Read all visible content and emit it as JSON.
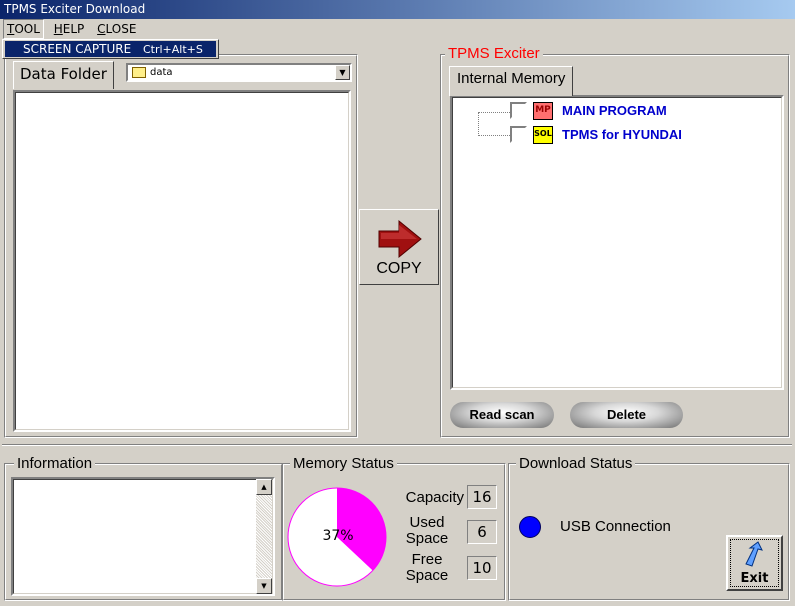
{
  "window": {
    "title": "TPMS Exciter Download"
  },
  "menu": {
    "items": [
      "TOOL",
      "HELP",
      "CLOSE"
    ],
    "open_dropdown": {
      "item": "SCREEN CAPTURE",
      "shortcut": "Ctrl+Alt+S"
    }
  },
  "left_panel": {
    "tab_label": "Data Folder",
    "folder_select": {
      "value": "data"
    }
  },
  "copy_button": {
    "label": "COPY",
    "icon": "red-arrow-right-icon",
    "icon_color": "#a01010"
  },
  "exciter": {
    "group_label": "TPMS Exciter",
    "group_label_color": "#ff0000",
    "tab_label": "Internal Memory",
    "tree": [
      {
        "icon_text": "MP",
        "label": "MAIN PROGRAM",
        "icon_color": "#ff7070"
      },
      {
        "icon_text": "SOL",
        "label": "TPMS for HYUNDAI",
        "icon_color": "#ffff00"
      }
    ],
    "buttons": {
      "read_scan": "Read scan",
      "delete": "Delete"
    }
  },
  "information": {
    "label": "Information"
  },
  "memory_status": {
    "label": "Memory Status",
    "percent_text": "37%",
    "used_fraction": 0.37,
    "pie_color": "#ff00ff",
    "capacity_label": "Capacity",
    "capacity": "16",
    "used_label_1": "Used",
    "used_label_2": "Space",
    "used": "6",
    "free_label_1": "Free",
    "free_label_2": "Space",
    "free": "10"
  },
  "download_status": {
    "label": "Download Status",
    "usb_label": "USB Connection",
    "usb_indicator_color": "#0000ff",
    "exit_label": "Exit"
  }
}
